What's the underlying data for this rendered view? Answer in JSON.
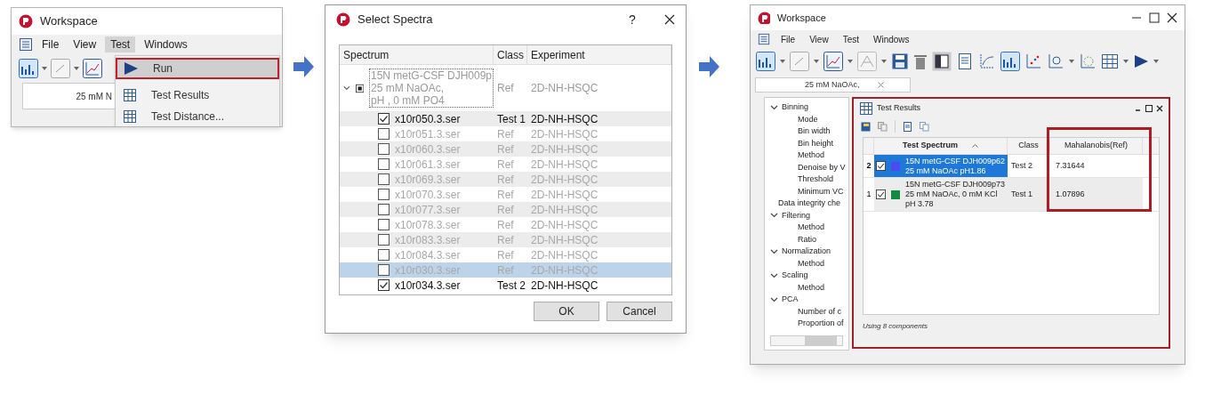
{
  "menu_screenshot": {
    "title": "Workspace",
    "menu": [
      {
        "label": "File",
        "selected": false
      },
      {
        "label": "View",
        "selected": false
      },
      {
        "label": "Test",
        "selected": true
      },
      {
        "label": "Windows",
        "selected": false
      }
    ],
    "tab_text": "25 mM N",
    "dropdown": [
      {
        "label": "Run",
        "kind": "run",
        "highlighted": true
      },
      {
        "label": "Test Results",
        "kind": "table",
        "highlighted": false
      },
      {
        "label": "Test Distance...",
        "kind": "table",
        "highlighted": false
      }
    ]
  },
  "select_spectra_dialog": {
    "title": "Select Spectra",
    "help": "?",
    "columns": [
      "Spectrum",
      "Class",
      "Experiment"
    ],
    "group": {
      "lines": [
        "15N metG-CSF DJH009p",
        "25 mM NaOAc,",
        "pH , 0 mM PO4"
      ],
      "class": "Ref",
      "experiment": "2D-NH-HSQC",
      "expanded": true,
      "partial": true
    },
    "rows": [
      {
        "name": "x10r050.3.ser",
        "class": "Test 1",
        "experiment": "2D-NH-HSQC",
        "checked": true,
        "selected": false
      },
      {
        "name": "x10r051.3.ser",
        "class": "Ref",
        "experiment": "2D-NH-HSQC",
        "checked": false,
        "selected": false
      },
      {
        "name": "x10r060.3.ser",
        "class": "Ref",
        "experiment": "2D-NH-HSQC",
        "checked": false,
        "selected": false
      },
      {
        "name": "x10r061.3.ser",
        "class": "Ref",
        "experiment": "2D-NH-HSQC",
        "checked": false,
        "selected": false
      },
      {
        "name": "x10r069.3.ser",
        "class": "Ref",
        "experiment": "2D-NH-HSQC",
        "checked": false,
        "selected": false
      },
      {
        "name": "x10r070.3.ser",
        "class": "Ref",
        "experiment": "2D-NH-HSQC",
        "checked": false,
        "selected": false
      },
      {
        "name": "x10r077.3.ser",
        "class": "Ref",
        "experiment": "2D-NH-HSQC",
        "checked": false,
        "selected": false
      },
      {
        "name": "x10r078.3.ser",
        "class": "Ref",
        "experiment": "2D-NH-HSQC",
        "checked": false,
        "selected": false
      },
      {
        "name": "x10r083.3.ser",
        "class": "Ref",
        "experiment": "2D-NH-HSQC",
        "checked": false,
        "selected": false
      },
      {
        "name": "x10r084.3.ser",
        "class": "Ref",
        "experiment": "2D-NH-HSQC",
        "checked": false,
        "selected": false
      },
      {
        "name": "x10r030.3.ser",
        "class": "Ref",
        "experiment": "2D-NH-HSQC",
        "checked": false,
        "selected": true
      },
      {
        "name": "x10r034.3.ser",
        "class": "Test 2",
        "experiment": "2D-NH-HSQC",
        "checked": true,
        "selected": false
      }
    ],
    "buttons": [
      "OK",
      "Cancel"
    ]
  },
  "results_window": {
    "title": "Workspace",
    "menu": [
      "File",
      "View",
      "Test",
      "Windows"
    ],
    "tab_text": "25 mM NaOAc,",
    "tree": [
      {
        "label": "Binning",
        "expanded": true,
        "children": [
          {
            "label": "Mode"
          },
          {
            "label": "Bin width"
          },
          {
            "label": "Bin height"
          },
          {
            "label": "Method"
          },
          {
            "label": "Denoise by V"
          },
          {
            "label": "Threshold"
          },
          {
            "label": "Minimum VC"
          }
        ]
      },
      {
        "label": "Data integrity che"
      },
      {
        "label": "Filtering",
        "expanded": true,
        "children": [
          {
            "label": "Method"
          },
          {
            "label": "Ratio"
          }
        ]
      },
      {
        "label": "Normalization",
        "expanded": true,
        "children": [
          {
            "label": "Method"
          }
        ]
      },
      {
        "label": "Scaling",
        "expanded": true,
        "children": [
          {
            "label": "Method"
          }
        ]
      },
      {
        "label": "PCA",
        "expanded": true,
        "children": [
          {
            "label": "Number of c"
          },
          {
            "label": "Proportion of"
          }
        ]
      }
    ],
    "test_results": {
      "title": "Test Results",
      "columns": [
        "Test Spectrum",
        "Class",
        "Mahalanobis(Ref)"
      ],
      "rows": [
        {
          "index": "2",
          "checked": true,
          "color": "#4b4bf2",
          "lines": [
            "15N metG-CSF DJH009p62",
            "25 mM NaOAc pH1.86"
          ],
          "class": "Test 2",
          "distance": "7.31644",
          "selected": true
        },
        {
          "index": "1",
          "checked": true,
          "color": "#128a44",
          "lines": [
            "15N metG-CSF DJH009p73",
            "25 mM NaOAc, 0 mM KCl",
            "pH 3.78"
          ],
          "class": "Test 1",
          "distance": "1.07896",
          "selected": false
        }
      ],
      "footer": "Using 8 components"
    }
  }
}
